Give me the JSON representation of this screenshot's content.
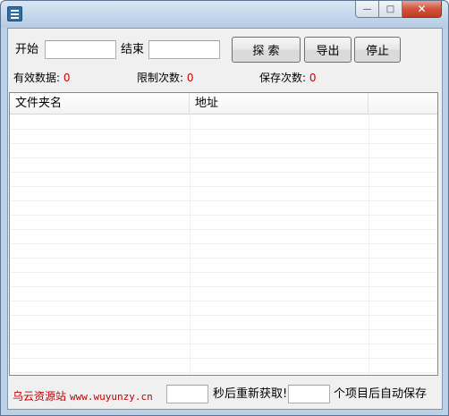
{
  "window": {
    "min_label": "—",
    "max_label": "□",
    "close_label": "✕"
  },
  "search": {
    "start_label": "开始",
    "start_value": "",
    "end_label": "结束",
    "end_value": "",
    "search_button": "探 索",
    "export_button": "导出",
    "stop_button": "停止"
  },
  "stats": {
    "valid_label": "有效数据:",
    "valid_value": "0",
    "limit_label": "限制次数:",
    "limit_value": "0",
    "save_label": "保存次数:",
    "save_value": "0"
  },
  "table": {
    "columns": [
      "文件夹名",
      "地址",
      ""
    ]
  },
  "footer": {
    "brand": "乌云资源站",
    "url": "www.wuyunzy.cn",
    "refresh_value": "",
    "refresh_label": "秒后重新获取!",
    "autosave_value": "",
    "autosave_label": "个项目后自动保存"
  },
  "colors": {
    "accent_red": "#cc0000",
    "brand_red": "#c00000"
  }
}
